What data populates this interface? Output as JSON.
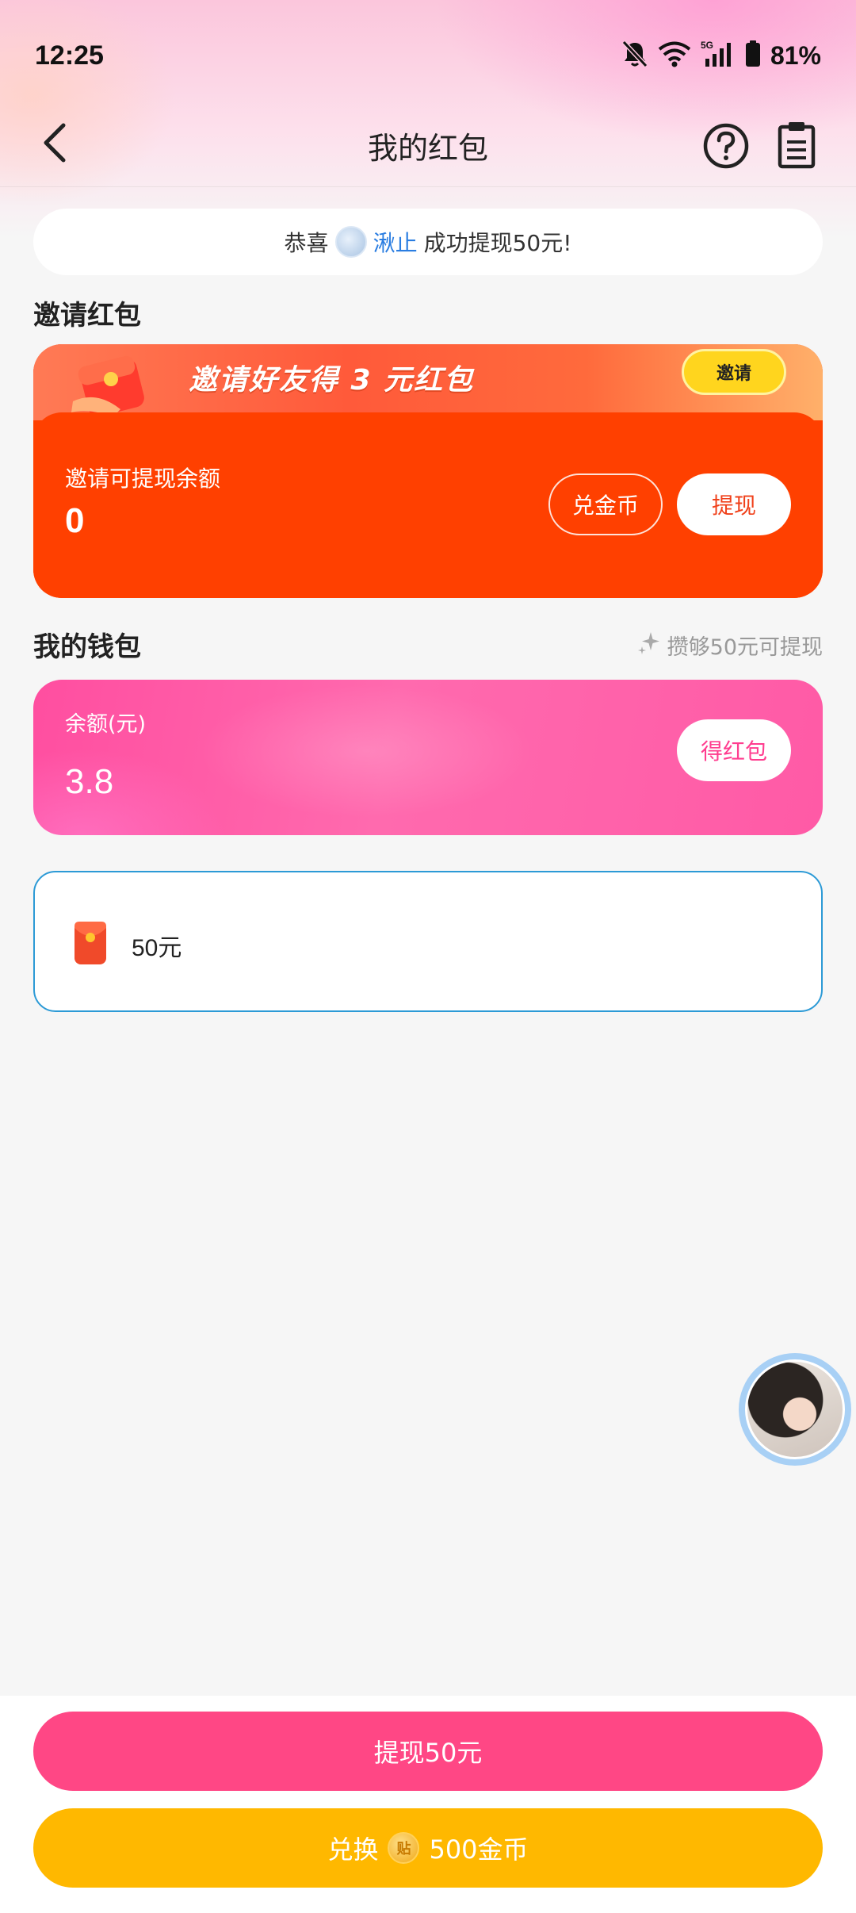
{
  "status_bar": {
    "time": "12:25",
    "battery": "81%",
    "network": "5G",
    "icons": [
      "bell-off-icon",
      "wifi-icon",
      "signal-icon",
      "battery-icon"
    ]
  },
  "header": {
    "title": "我的红包",
    "back_icon": "chevron-left-icon",
    "help_icon": "question-circle-icon",
    "records_icon": "clipboard-icon"
  },
  "ticker": {
    "prefix": "恭喜",
    "name": "湫止",
    "suffix": "成功提现50元!"
  },
  "invite_section": {
    "title": "邀请红包",
    "banner_text": "邀请好友得 3 元红包",
    "invite_button": "邀请",
    "balance_label": "邀请可提现余额",
    "balance_value": "0",
    "exchange_coin_button": "兑金币",
    "withdraw_button": "提现"
  },
  "wallet_section": {
    "title": "我的钱包",
    "tip": "攒够50元可提现",
    "balance_label": "余额(元)",
    "balance_value": "3.8",
    "get_button": "得红包"
  },
  "withdraw_options": [
    {
      "label": "50元",
      "icon": "red-envelope-icon",
      "selected": true
    }
  ],
  "bottom": {
    "withdraw_button": "提现50元",
    "exchange_prefix": "兑换",
    "coin_glyph": "贴",
    "exchange_suffix": "500金币"
  },
  "colors": {
    "primary_pink": "#ff4785",
    "exchange_yellow": "#ffb800",
    "invite_orange": "#ff4000",
    "link_blue": "#2a7de1",
    "option_border": "#2c9ad6"
  }
}
